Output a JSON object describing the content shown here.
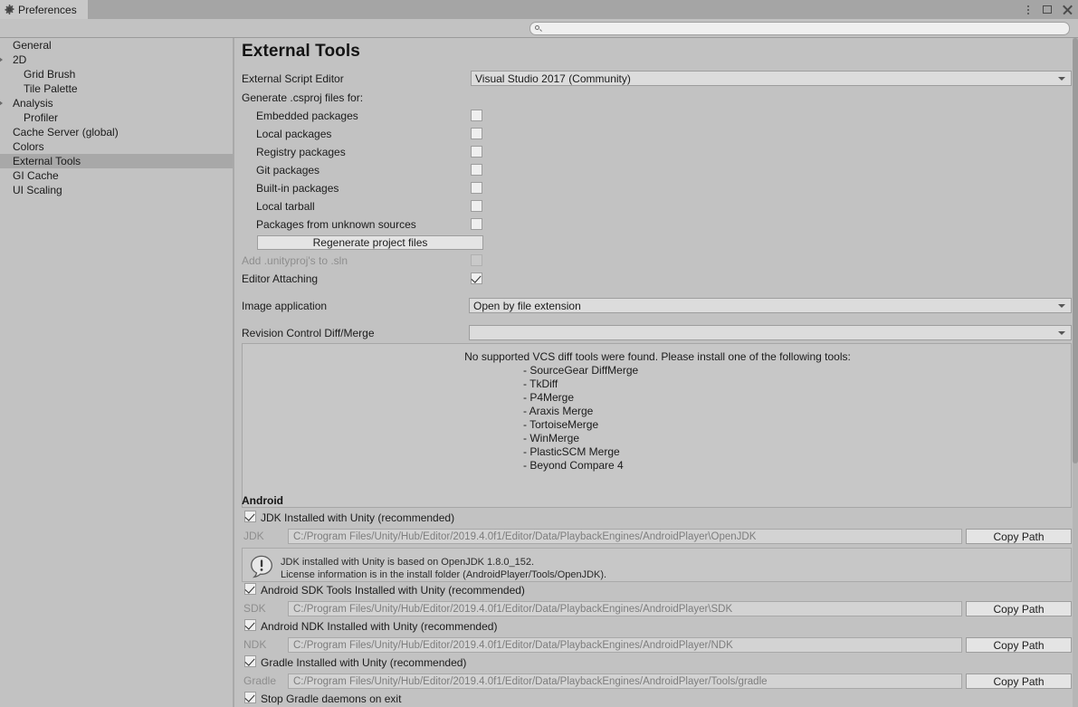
{
  "window": {
    "tab_label": "Preferences",
    "tab_icon": "gear-icon",
    "menu_icon": "kebab-menu-icon",
    "maximize_icon": "maximize-icon",
    "close_icon": "close-icon"
  },
  "search": {
    "value": "",
    "placeholder": "",
    "icon": "search-icon"
  },
  "sidebar": {
    "items": [
      {
        "label": "General",
        "indent": 0,
        "foldout": false,
        "selected": false
      },
      {
        "label": "2D",
        "indent": 0,
        "foldout": true,
        "selected": false
      },
      {
        "label": "Grid Brush",
        "indent": 1,
        "foldout": false,
        "selected": false
      },
      {
        "label": "Tile Palette",
        "indent": 1,
        "foldout": false,
        "selected": false
      },
      {
        "label": "Analysis",
        "indent": 0,
        "foldout": true,
        "selected": false
      },
      {
        "label": "Profiler",
        "indent": 1,
        "foldout": false,
        "selected": false
      },
      {
        "label": "Cache Server (global)",
        "indent": 0,
        "foldout": false,
        "selected": false
      },
      {
        "label": "Colors",
        "indent": 0,
        "foldout": false,
        "selected": false
      },
      {
        "label": "External Tools",
        "indent": 0,
        "foldout": false,
        "selected": true
      },
      {
        "label": "GI Cache",
        "indent": 0,
        "foldout": false,
        "selected": false
      },
      {
        "label": "UI Scaling",
        "indent": 0,
        "foldout": false,
        "selected": false
      }
    ]
  },
  "main": {
    "title": "External Tools",
    "script_editor": {
      "label": "External Script Editor",
      "value": "Visual Studio 2017 (Community)"
    },
    "csproj": {
      "label": "Generate .csproj files for:",
      "options": [
        {
          "label": "Embedded packages",
          "checked": false
        },
        {
          "label": "Local packages",
          "checked": false
        },
        {
          "label": "Registry packages",
          "checked": false
        },
        {
          "label": "Git packages",
          "checked": false
        },
        {
          "label": "Built-in packages",
          "checked": false
        },
        {
          "label": "Local tarball",
          "checked": false
        },
        {
          "label": "Packages from unknown sources",
          "checked": false
        }
      ],
      "regenerate_button": "Regenerate project files"
    },
    "add_unityproj": {
      "label": "Add .unityproj's to .sln",
      "checked": false,
      "disabled": true
    },
    "editor_attaching": {
      "label": "Editor Attaching",
      "checked": true
    },
    "image_application": {
      "label": "Image application",
      "value": "Open by file extension"
    },
    "revision_control": {
      "label": "Revision Control Diff/Merge",
      "value": ""
    },
    "vcs_help": {
      "heading": "No supported VCS diff tools were found. Please install one of the following tools:",
      "tools": [
        "- SourceGear DiffMerge",
        "- TkDiff",
        "- P4Merge",
        "- Araxis Merge",
        "- TortoiseMerge",
        "- WinMerge",
        "- PlasticSCM Merge",
        "- Beyond Compare 4"
      ]
    },
    "android": {
      "heading": "Android",
      "jdk": {
        "toggle_label": "JDK Installed with Unity (recommended)",
        "toggle_checked": true,
        "field_label": "JDK",
        "path": "C:/Program Files/Unity/Hub/Editor/2019.4.0f1/Editor/Data/PlaybackEngines/AndroidPlayer\\OpenJDK",
        "copy_button": "Copy Path",
        "info_icon": "warning-icon",
        "info_line1": "JDK installed with Unity is based on OpenJDK 1.8.0_152.",
        "info_line2": "License information is in the install folder (AndroidPlayer/Tools/OpenJDK)."
      },
      "sdk": {
        "toggle_label": "Android SDK Tools Installed with Unity (recommended)",
        "toggle_checked": true,
        "field_label": "SDK",
        "path": "C:/Program Files/Unity/Hub/Editor/2019.4.0f1/Editor/Data/PlaybackEngines/AndroidPlayer\\SDK",
        "copy_button": "Copy Path"
      },
      "ndk": {
        "toggle_label": "Android NDK Installed with Unity (recommended)",
        "toggle_checked": true,
        "field_label": "NDK",
        "path": "C:/Program Files/Unity/Hub/Editor/2019.4.0f1/Editor/Data/PlaybackEngines/AndroidPlayer/NDK",
        "copy_button": "Copy Path"
      },
      "gradle": {
        "toggle_label": "Gradle Installed with Unity (recommended)",
        "toggle_checked": true,
        "field_label": "Gradle",
        "path": "C:/Program Files/Unity/Hub/Editor/2019.4.0f1/Editor/Data/PlaybackEngines/AndroidPlayer/Tools/gradle",
        "copy_button": "Copy Path"
      },
      "stop_daemons": {
        "label": "Stop Gradle daemons on exit",
        "checked": true
      }
    }
  },
  "scrollbar": {
    "name": "vertical-scrollbar"
  }
}
